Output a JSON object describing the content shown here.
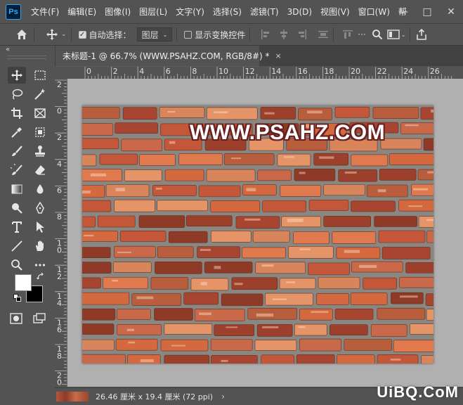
{
  "app": {
    "logo_text": "Ps"
  },
  "menu": {
    "items": [
      "文件(F)",
      "编辑(E)",
      "图像(I)",
      "图层(L)",
      "文字(Y)",
      "选择(S)",
      "滤镜(T)",
      "3D(D)",
      "视图(V)",
      "窗口(W)",
      "帮"
    ]
  },
  "window_controls": {
    "minimize": "—",
    "maximize": "□",
    "close": "✕"
  },
  "options_bar": {
    "auto_select_label": "自动选择：",
    "auto_select_checked": true,
    "layer_dropdown_value": "图层",
    "show_transform_label": "显示变换控件",
    "show_transform_checked": false
  },
  "document_tab": {
    "title": "未标题-1 @ 66.7% (WWW.PSAHZ.COM, RGB/8#) *",
    "close": "×"
  },
  "toolbar": {
    "collapse_glyph": "«"
  },
  "ruler": {
    "top_labels": [
      "0",
      "2",
      "4",
      "6",
      "8",
      "10",
      "12",
      "14",
      "16",
      "18",
      "20",
      "22",
      "24",
      "26"
    ],
    "left_labels": [
      "2",
      "0",
      "2",
      "4",
      "6",
      "8",
      "1\n0",
      "1\n2",
      "1\n4",
      "1\n6",
      "1\n8",
      "2\n0"
    ]
  },
  "canvas": {
    "watermark_text": "WWW.PSAHZ.COM",
    "brick_colors": [
      "#c4573a",
      "#d4683f",
      "#a84530",
      "#e07a4e",
      "#b85e3d",
      "#9c3f2b",
      "#d9855c",
      "#c9694a",
      "#8e3a27",
      "#e59468"
    ],
    "mortar_color": "#8b8680"
  },
  "status_bar": {
    "size_text": "26.46 厘米 x 19.4 厘米 (72 ppi)",
    "arrow": "›"
  },
  "site_watermark": "UiBQ.CoM"
}
